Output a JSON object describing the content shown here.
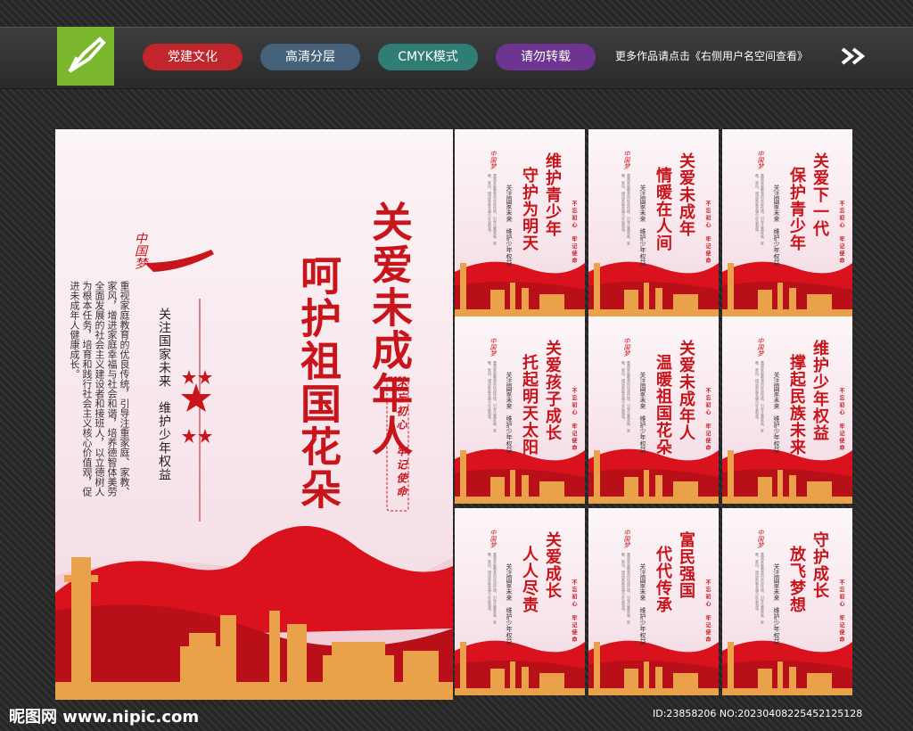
{
  "header": {
    "tags": [
      {
        "label": "党建文化",
        "color": "#c0262c"
      },
      {
        "label": "高清分层",
        "color": "#46627a"
      },
      {
        "label": "CMYK模式",
        "color": "#2f7d75"
      },
      {
        "label": "请勿转载",
        "color": "#6d3591"
      }
    ],
    "more_text": "更多作品请点击《右侧用户名空间查看》"
  },
  "main_poster": {
    "brand": "中国梦",
    "title_line1": "关爱未成年人",
    "title_line2": "呵护祖国花朵",
    "subtitle": "关注国家未来　维护少年权益",
    "body": "重视家庭教育的优良传统，引导注重家庭、家教、家风，增进家庭幸福与社会和谐，培养德智体美劳全面发展的社会主义建设者和接班人，以立德树人为根本任务，培育和践行社会主义核心价值观，促进未成年人健康成长。",
    "motto": "不忘初心　牢记使命"
  },
  "small_posters": [
    {
      "line1": "维护青少年",
      "line2": "守护为明天"
    },
    {
      "line1": "关爱未成年",
      "line2": "情暖在人间"
    },
    {
      "line1": "关爱下一代",
      "line2": "保护青少年"
    },
    {
      "line1": "关爱孩子成长",
      "line2": "托起明天太阳"
    },
    {
      "line1": "关爱未成年人",
      "line2": "温暖祖国花朵"
    },
    {
      "line1": "维护少年权益",
      "line2": "撑起民族未来"
    },
    {
      "line1": "关爱成长",
      "line2": "人人尽责"
    },
    {
      "line1": "富民强国",
      "line2": "代代传承"
    },
    {
      "line1": "守护成长",
      "line2": "放飞梦想"
    }
  ],
  "small_common": {
    "brand": "中国梦",
    "subtitle": "关注国家未来　维护少年权益",
    "motto": "不忘初心　牢记使命",
    "body": "重视家庭教育的优良传统，引导注重家庭、家教、家风，增进家庭幸福与社会和谐。"
  },
  "footer": {
    "site": "昵图网 www.nipic.com",
    "id_text": "ID:23858206 NO:20230408225452125128"
  },
  "colors": {
    "accent_red": "#c8151b",
    "logo_green": "#7ab72c"
  }
}
